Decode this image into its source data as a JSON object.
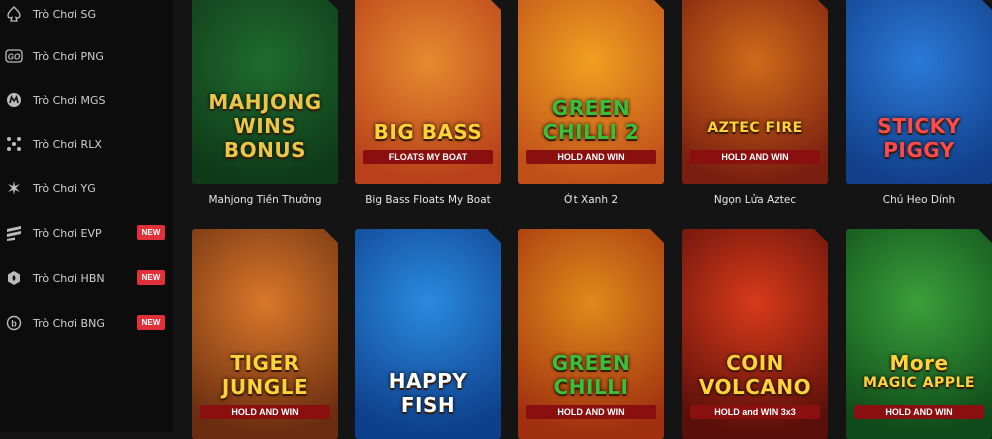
{
  "sidebar": {
    "items": [
      {
        "label": "Trò Chơi SG",
        "icon": "spade-icon",
        "badge": ""
      },
      {
        "label": "Trò Chơi PNG",
        "icon": "go-logo-icon",
        "badge": ""
      },
      {
        "label": "Trò Chơi MGS",
        "icon": "m-logo-icon",
        "badge": ""
      },
      {
        "label": "Trò Chơi RLX",
        "icon": "dots-icon",
        "badge": ""
      },
      {
        "label": "Trò Chơi YG",
        "icon": "star-burst-icon",
        "badge": ""
      },
      {
        "label": "Trò Chơi EVP",
        "icon": "stripes-icon",
        "badge": "NEW"
      },
      {
        "label": "Trò Chơi HBN",
        "icon": "flame-badge-icon",
        "badge": "NEW"
      },
      {
        "label": "Trò Chơi BNG",
        "icon": "b-circle-icon",
        "badge": "NEW"
      }
    ]
  },
  "games": [
    {
      "title": "Mahjong Tiền Thưởng",
      "art_lines": [
        "MAHJONG",
        "WINS",
        "BONUS"
      ],
      "art_sub": "",
      "colors": [
        "#1f6b2f",
        "#0f3a18"
      ],
      "logo_color": "#e8c64a"
    },
    {
      "title": "Big Bass Floats My Boat",
      "art_lines": [
        "BIG BASS"
      ],
      "art_sub": "FLOATS MY BOAT",
      "colors": [
        "#e68a2e",
        "#b8401a"
      ],
      "logo_color": "#ffd23a"
    },
    {
      "title": "Ớt Xanh 2",
      "art_lines": [
        "GREEN",
        "CHILLI 2"
      ],
      "art_sub": "HOLD AND WIN",
      "colors": [
        "#f0a020",
        "#c0501a"
      ],
      "logo_color": "#3bbf3b"
    },
    {
      "title": "Ngọn Lửa Aztec",
      "art_lines": [
        "AZTEC FIRE"
      ],
      "art_sub": "HOLD AND WIN",
      "colors": [
        "#d06a1a",
        "#7a1f10"
      ],
      "logo_color": "#ffd23a"
    },
    {
      "title": "Chú Heo Dính",
      "art_lines": [
        "STICKY",
        "PIGGY"
      ],
      "art_sub": "",
      "colors": [
        "#2a7ad8",
        "#123f8a"
      ],
      "logo_color": "#ff4a4a"
    },
    {
      "title": "",
      "art_lines": [
        "TIGER",
        "JUNGLE"
      ],
      "art_sub": "HOLD AND WIN",
      "colors": [
        "#d9782a",
        "#6a2d10"
      ],
      "logo_color": "#ffd23a"
    },
    {
      "title": "",
      "art_lines": [
        "HAPPY",
        "FISH"
      ],
      "art_sub": "",
      "colors": [
        "#2a8ae0",
        "#0e3f8a"
      ],
      "logo_color": "#ffffff"
    },
    {
      "title": "",
      "art_lines": [
        "GREEN",
        "CHILLI"
      ],
      "art_sub": "HOLD AND WIN",
      "colors": [
        "#e08a1a",
        "#a03010"
      ],
      "logo_color": "#3bbf3b"
    },
    {
      "title": "",
      "art_lines": [
        "COIN",
        "VOLCANO"
      ],
      "art_sub": "HOLD and WIN 3x3",
      "colors": [
        "#d83a1a",
        "#5a0f0a"
      ],
      "logo_color": "#ffd23a"
    },
    {
      "title": "",
      "art_lines": [
        "More",
        "MAGIC APPLE"
      ],
      "art_sub": "HOLD AND WIN",
      "colors": [
        "#3aa03a",
        "#0f4a1a"
      ],
      "logo_color": "#ffd23a"
    }
  ],
  "colors": {
    "badge": "#e0303a",
    "sidebar_bg": "#0c0c0c",
    "page_bg": "#141414"
  }
}
